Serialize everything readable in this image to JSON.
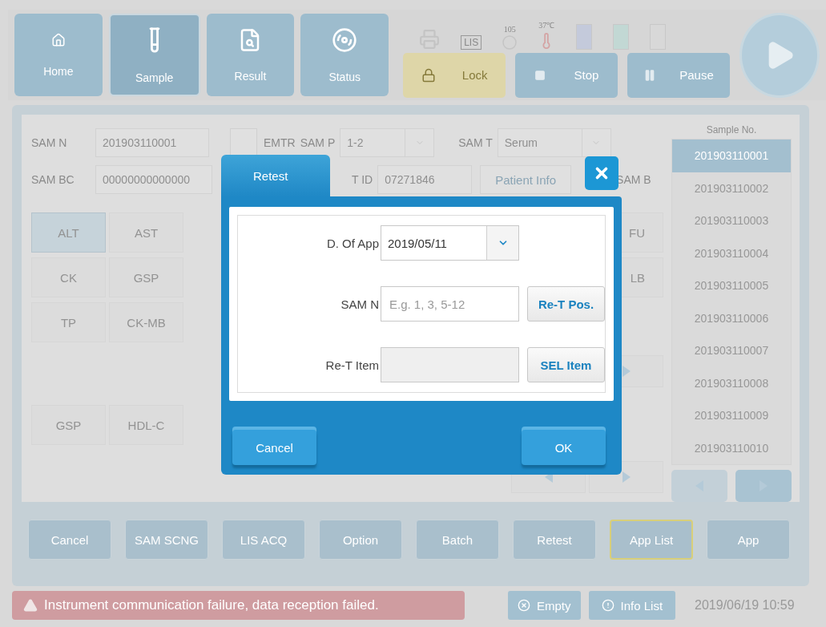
{
  "nav": [
    {
      "label": "Home",
      "selected": false
    },
    {
      "label": "Sample",
      "selected": true
    },
    {
      "label": "Result",
      "selected": false
    },
    {
      "label": "Status",
      "selected": false
    }
  ],
  "indicators": {
    "lis": "LIS",
    "count": "105",
    "temperature": "37℃"
  },
  "controls": [
    {
      "label": "Lock",
      "kind": "lock"
    },
    {
      "label": "Stop",
      "kind": "stop"
    },
    {
      "label": "Pause",
      "kind": "pause"
    }
  ],
  "form": {
    "sam_n_label": "SAM N",
    "sam_n_value": "201903110001",
    "emtr_checked": false,
    "emtr_label": "EMTR",
    "sam_p_label": "SAM P",
    "sam_p_value": "1-2",
    "sam_t_label": "SAM T",
    "sam_t_value": "Serum",
    "sam_bc_label": "SAM BC",
    "sam_bc_value": "00000000000000",
    "t_id_label": "T ID",
    "t_id_value": "07271846",
    "patient_info": "Patient Info",
    "sam_b_label": "SAM B"
  },
  "test_rows": [
    {
      "left": [
        {
          "label": "ALT",
          "selected": true
        },
        {
          "label": "AST",
          "selected": false
        }
      ],
      "right": [
        {
          "label": "FU",
          "selected": false
        }
      ]
    },
    {
      "left": [
        {
          "label": "CK",
          "selected": false
        },
        {
          "label": "GSP",
          "selected": false
        }
      ],
      "right": [
        {
          "label": "LB",
          "selected": false
        }
      ]
    },
    {
      "left": [
        {
          "label": "TP",
          "selected": false
        },
        {
          "label": "CK-MB",
          "selected": false
        }
      ]
    }
  ],
  "test_rows_2": [
    {
      "left": [
        {
          "label": "GSP",
          "selected": false
        },
        {
          "label": "HDL-C",
          "selected": false
        }
      ]
    }
  ],
  "sample_list": {
    "header": "Sample No.",
    "items": [
      {
        "label": "201903110001",
        "selected": true
      },
      {
        "label": "201903110002",
        "selected": false
      },
      {
        "label": "201903110003",
        "selected": false
      },
      {
        "label": "201903110004",
        "selected": false
      },
      {
        "label": "201903110005",
        "selected": false
      },
      {
        "label": "201903110006",
        "selected": false
      },
      {
        "label": "201903110007",
        "selected": false
      },
      {
        "label": "201903110008",
        "selected": false
      },
      {
        "label": "201903110009",
        "selected": false
      },
      {
        "label": "201903110010",
        "selected": false
      }
    ]
  },
  "actions": [
    {
      "label": "Cancel",
      "highlighted": false
    },
    {
      "label": "SAM SCNG",
      "highlighted": false
    },
    {
      "label": "LIS ACQ",
      "highlighted": false
    },
    {
      "label": "Option",
      "highlighted": false
    },
    {
      "label": "Batch",
      "highlighted": false
    },
    {
      "label": "Retest",
      "highlighted": false
    },
    {
      "label": "App List",
      "highlighted": true
    },
    {
      "label": "App",
      "highlighted": false
    }
  ],
  "status_bar": {
    "message": "Instrument communication failure, data reception failed.",
    "empty": "Empty",
    "info_list": "Info List",
    "time": "2019/06/19 10:59"
  },
  "dialog": {
    "title": "Retest",
    "date_label": "D. Of App",
    "date_value": "2019/05/11",
    "sam_n_label": "SAM N",
    "sam_n_placeholder": "E.g. 1, 3, 5-12",
    "retest_pos": "Re-T Pos.",
    "item_label": "Re-T Item",
    "sel_item": "SEL Item",
    "cancel": "Cancel",
    "ok": "OK"
  }
}
